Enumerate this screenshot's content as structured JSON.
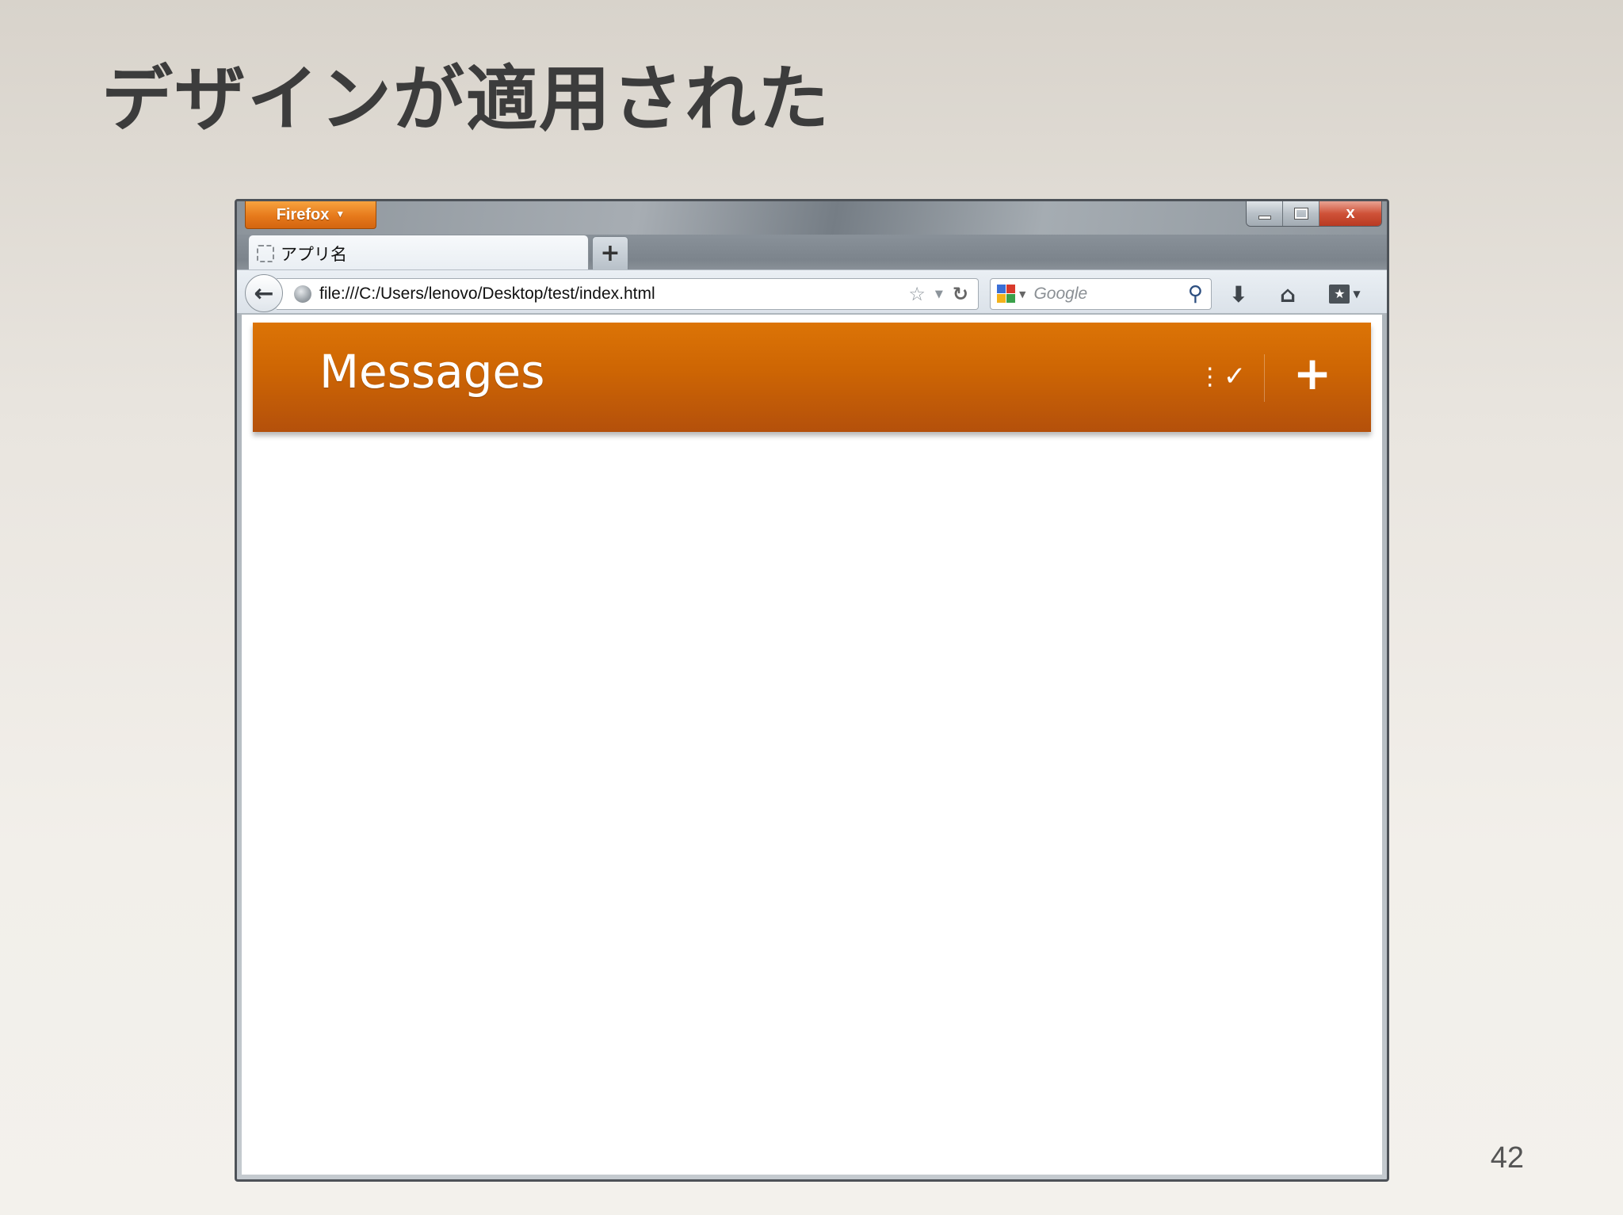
{
  "slide": {
    "title": "デザインが適用された",
    "page_number": "42"
  },
  "browser": {
    "app_button_label": "Firefox",
    "window_controls": {
      "close_label": "x"
    },
    "tabs": [
      {
        "label": "アプリ名"
      }
    ],
    "new_tab_label": "+",
    "url": "file:///C:/Users/lenovo/Desktop/test/index.html",
    "search": {
      "placeholder": "Google"
    }
  },
  "app": {
    "header": {
      "title": "Messages",
      "add_label": "+"
    },
    "colors": {
      "header_top": "#dc7406",
      "header_bottom": "#b4500b"
    }
  }
}
